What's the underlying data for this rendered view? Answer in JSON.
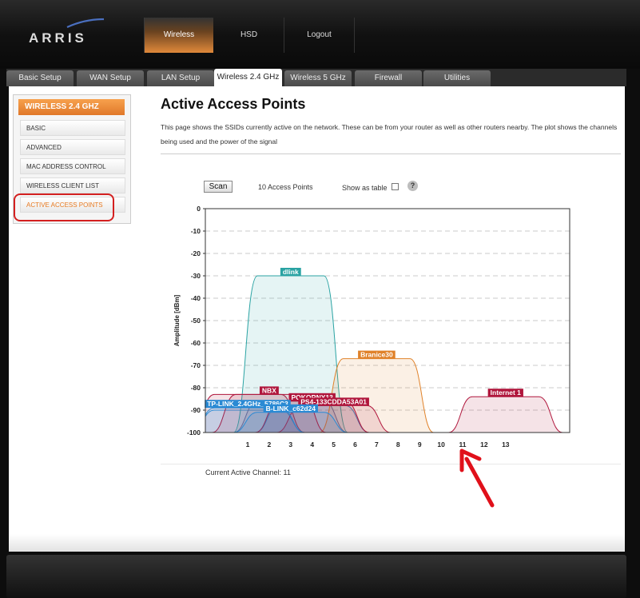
{
  "header": {
    "logo_text": "ARRIS",
    "nav": [
      {
        "label": "Wireless",
        "active": true
      },
      {
        "label": "HSD"
      },
      {
        "label": "Logout"
      }
    ]
  },
  "tabs": [
    {
      "label": "Basic Setup"
    },
    {
      "label": "WAN Setup"
    },
    {
      "label": "LAN Setup"
    },
    {
      "label": "Wireless 2.4 GHz",
      "active": true
    },
    {
      "label": "Wireless 5 GHz"
    },
    {
      "label": "Firewall"
    },
    {
      "label": "Utilities"
    }
  ],
  "sidebar": {
    "header": "WIRELESS 2.4 GHZ",
    "items": [
      {
        "label": "BASIC"
      },
      {
        "label": "ADVANCED"
      },
      {
        "label": "MAC ADDRESS CONTROL"
      },
      {
        "label": "WIRELESS CLIENT LIST"
      },
      {
        "label": "ACTIVE ACCESS POINTS",
        "active": true
      }
    ]
  },
  "main": {
    "title": "Active Access Points",
    "description": "This page shows the SSIDs currently active on the network. These can be from your router as well as other routers nearby. The plot shows the channels being used and the power of the signal",
    "scan_label": "Scan",
    "ap_count": "10 Access Points",
    "show_table_label": "Show as table",
    "help_icon": "?",
    "current_channel": "Current Active Channel: 11"
  },
  "colors": {
    "accent": "#e87a21",
    "annotation": "#d42020"
  },
  "chart_data": {
    "type": "area",
    "ylabel": "Amplitude [dBm]",
    "ylim": [
      -100,
      0
    ],
    "yticks": [
      0,
      -10,
      -20,
      -30,
      -40,
      -50,
      -60,
      -70,
      -80,
      -90,
      -100
    ],
    "xticks": [
      1,
      2,
      3,
      4,
      5,
      6,
      7,
      8,
      9,
      10,
      11,
      12,
      13
    ],
    "grid": true,
    "series": [
      {
        "name": "dlink",
        "channel": 3,
        "level": -30,
        "color": "#2aa3a3"
      },
      {
        "name": "Branice30",
        "channel": 7,
        "level": -67,
        "color": "#e0822a"
      },
      {
        "name": "NBX",
        "channel": 2,
        "level": -83,
        "color": "#b0163c"
      },
      {
        "name": "POKORNY13",
        "channel": 4,
        "level": -86,
        "color": "#b0163c"
      },
      {
        "name": "PS4-133CDDA53A01",
        "channel": 5,
        "level": -88,
        "color": "#b0163c"
      },
      {
        "name": "Internet 1",
        "channel": 13,
        "level": -84,
        "color": "#b0163c"
      },
      {
        "name": "TP-LINK_2.4GHz_5786C3",
        "channel": 1,
        "level": -89,
        "color": "#2a8ad4"
      },
      {
        "name": "B-LINK_c62d24",
        "channel": 3,
        "level": -91,
        "color": "#2a8ad4"
      }
    ],
    "extra_traces": [
      {
        "channel": 1,
        "level": -83,
        "color": "#b0163c"
      },
      {
        "channel": 1,
        "level": -90,
        "color": "#2a8ad4"
      },
      {
        "channel": 3,
        "level": -86,
        "color": "#6a6aa0"
      },
      {
        "channel": 4,
        "level": -88,
        "color": "#2a8ad4"
      }
    ]
  }
}
